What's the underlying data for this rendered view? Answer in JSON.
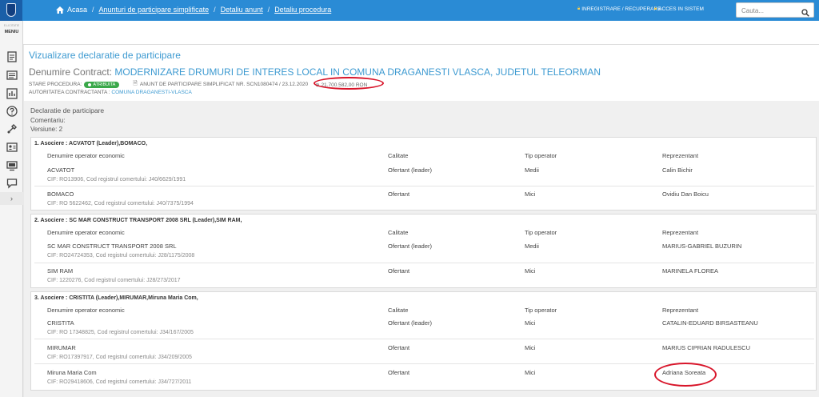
{
  "breadcrumb": {
    "home": "Acasa",
    "items": [
      "Anunturi de participare simplificate",
      "Detaliu anunt",
      "Detaliu procedura"
    ]
  },
  "auth": {
    "register": "INREGISTRARE / RECUPERARE",
    "login": "ACCES IN SISTEM"
  },
  "search": {
    "placeholder": "Cauta..."
  },
  "sidebar": {
    "small_label": "E-LICITATIE",
    "menu_label": "MENIU",
    "icons": [
      "clipboard-icon",
      "list-icon",
      "report-icon",
      "help-icon",
      "tools-icon",
      "id-card-icon",
      "monitor-icon",
      "chat-icon"
    ]
  },
  "header": {
    "view_title": "Vizualizare declaratie de participare",
    "contract_label": "Denumire Contract:",
    "contract_name": "MODERNIZARE DRUMURI DE INTERES LOCAL IN COMUNA DRAGANESTI VLASCA, JUDETUL TELEORMAN",
    "status_label": "STARE PROCEDURA:",
    "status_value": "ATRIBUITA",
    "notice_text": "ANUNT DE PARTICIPARE SIMPLIFICAT NR. SCN1080474 / 23.12.2020",
    "amount": "21.700.582,00",
    "currency": "RON",
    "authority_label": "AUTORITATEA CONTRACTANTA :",
    "authority_value": "COMUNA DRAGANESTI-VLASCA"
  },
  "declaration": {
    "title": "Declaratie de participare",
    "comments_label": "Comentariu:",
    "version_label": "Versiune: 2"
  },
  "columns": {
    "operator": "Denumire operator economic",
    "quality": "Calitate",
    "type": "Tip operator",
    "representative": "Reprezentant"
  },
  "groups": [
    {
      "title": "1. Asociere : ACVATOT (Leader),BOMACO,",
      "rows": [
        {
          "name": "ACVATOT",
          "cif": "CIF: RO13906, Cod registrul comertului: J40/6629/1991",
          "quality": "Ofertant (leader)",
          "type": "Medii",
          "rep": "Calin Bichir"
        },
        {
          "name": "BOMACO",
          "cif": "CIF: RO 5622462, Cod registrul comertului: J40/7375/1994",
          "quality": "Ofertant",
          "type": "Mici",
          "rep": "Ovidiu Dan Boicu"
        }
      ]
    },
    {
      "title": "2. Asociere : SC MAR CONSTRUCT TRANSPORT 2008 SRL (Leader),SIM RAM,",
      "rows": [
        {
          "name": "SC MAR CONSTRUCT TRANSPORT 2008 SRL",
          "cif": "CIF: RO24724353, Cod registrul comertului: J28/1175/2008",
          "quality": "Ofertant (leader)",
          "type": "Medii",
          "rep": "MARIUS-GABRIEL BUZURIN"
        },
        {
          "name": "SIM RAM",
          "cif": "CIF: 1220276, Cod registrul comertului: J28/273/2017",
          "quality": "Ofertant",
          "type": "Mici",
          "rep": "MARINELA FLOREA"
        }
      ]
    },
    {
      "title": "3. Asociere : CRISTITA (Leader),MIRUMAR,Miruna Maria Com,",
      "rows": [
        {
          "name": "CRISTITA",
          "cif": "CIF: RO 17348825, Cod registrul comertului: J34/167/2005",
          "quality": "Ofertant (leader)",
          "type": "Mici",
          "rep": "CATALIN-EDUARD BIRSASTEANU"
        },
        {
          "name": "MIRUMAR",
          "cif": "CIF: RO17397917, Cod registrul comertului: J34/209/2005",
          "quality": "Ofertant",
          "type": "Mici",
          "rep": "MARIUS CIPRIAN RADULESCU"
        },
        {
          "name": "Miruna Maria Com",
          "cif": "CIF: RO29418606, Cod registrul comertului: J34/727/2011",
          "quality": "Ofertant",
          "type": "Mici",
          "rep": "Adriana Soreata"
        }
      ]
    }
  ],
  "colors": {
    "topbar": "#2a8bd5",
    "accent": "#3d9ad1",
    "status_green": "#3aa84a",
    "annotation_red": "#d8152a"
  }
}
